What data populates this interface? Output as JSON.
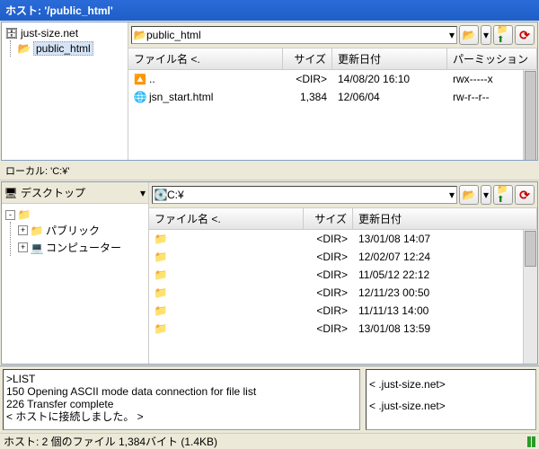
{
  "host": {
    "title": "ホスト: '/public_html'",
    "tree": {
      "root": "just-size.net",
      "child": "public_html"
    },
    "path": "public_html",
    "columns": {
      "name": "ファイル名 <.",
      "size": "サイズ",
      "date": "更新日付",
      "perm": "パーミッション"
    },
    "rows": [
      {
        "icon": "up",
        "name": "..",
        "size": "<DIR>",
        "date": "14/08/20 16:10",
        "perm": "rwx-----x"
      },
      {
        "icon": "html",
        "name": "jsn_start.html",
        "size": "1,384",
        "date": "12/06/04",
        "perm": "rw-r--r--"
      }
    ]
  },
  "local": {
    "title": "ローカル: 'C:¥'",
    "tree_head": "デスクトップ",
    "tree": {
      "items": [
        {
          "label": "パブリック",
          "exp": "+"
        },
        {
          "label": "コンピューター",
          "exp": "+"
        }
      ],
      "blank": ""
    },
    "path": "C:¥",
    "columns": {
      "name": "ファイル名 <.",
      "size": "サイズ",
      "date": "更新日付"
    },
    "rows": [
      {
        "name": "",
        "size": "<DIR>",
        "date": "13/01/08 14:07"
      },
      {
        "name": "",
        "size": "<DIR>",
        "date": "12/02/07 12:24"
      },
      {
        "name": "",
        "size": "<DIR>",
        "date": "11/05/12 22:12"
      },
      {
        "name": "",
        "size": "<DIR>",
        "date": "12/11/23 00:50"
      },
      {
        "name": "",
        "size": "<DIR>",
        "date": "11/11/13 14:00"
      },
      {
        "name": "",
        "size": "<DIR>",
        "date": "13/01/08 13:59"
      }
    ]
  },
  "log": {
    "left": [
      ">LIST",
      "150 Opening ASCII mode data connection for file list",
      "226 Transfer complete",
      "< ホストに接続しました。 >"
    ],
    "right": [
      "<          .just-size.net>",
      "<          .just-size.net>"
    ]
  },
  "status": "ホスト: 2 個のファイル  1,384バイト (1.4KB)"
}
